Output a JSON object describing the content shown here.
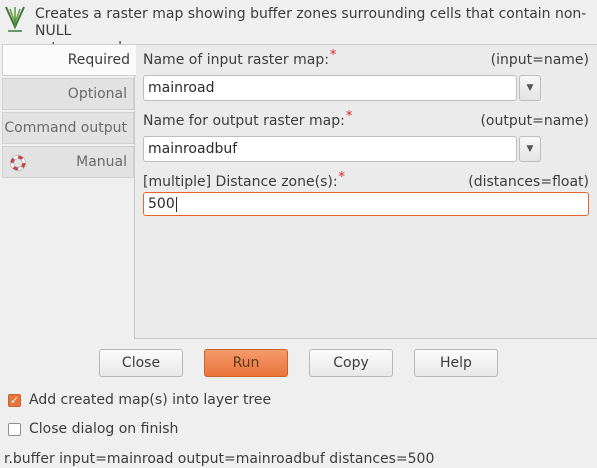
{
  "header": {
    "description": "Creates a raster map showing buffer zones surrounding cells that contain non-NULL\ncategory values.",
    "logo_icon": "grass-logo-icon"
  },
  "tabs": [
    {
      "label": "Required",
      "active": true
    },
    {
      "label": "Optional",
      "active": false
    },
    {
      "label": "Command output",
      "active": false
    },
    {
      "label": "Manual",
      "active": false,
      "icon": "lifebuoy-icon"
    }
  ],
  "fields": {
    "input": {
      "label": "Name of input raster map:",
      "required_mark": "*",
      "hint": "(input=name)",
      "value": "mainroad"
    },
    "output": {
      "label": "Name for output raster map:",
      "required_mark": "*",
      "hint": "(output=name)",
      "value": "mainroadbuf"
    },
    "distances": {
      "label": "[multiple] Distance zone(s):",
      "required_mark": "*",
      "hint": "(distances=float)",
      "value": "500"
    }
  },
  "buttons": {
    "close": "Close",
    "run": "Run",
    "copy": "Copy",
    "help": "Help"
  },
  "options": {
    "add_to_layer_tree": {
      "label": "Add created map(s) into layer tree",
      "checked": true
    },
    "close_on_finish": {
      "label": "Close dialog on finish",
      "checked": false
    }
  },
  "command_preview": "r.buffer input=mainroad output=mainroadbuf distances=500",
  "colors": {
    "accent": "#e9743c",
    "required": "#e02020"
  }
}
